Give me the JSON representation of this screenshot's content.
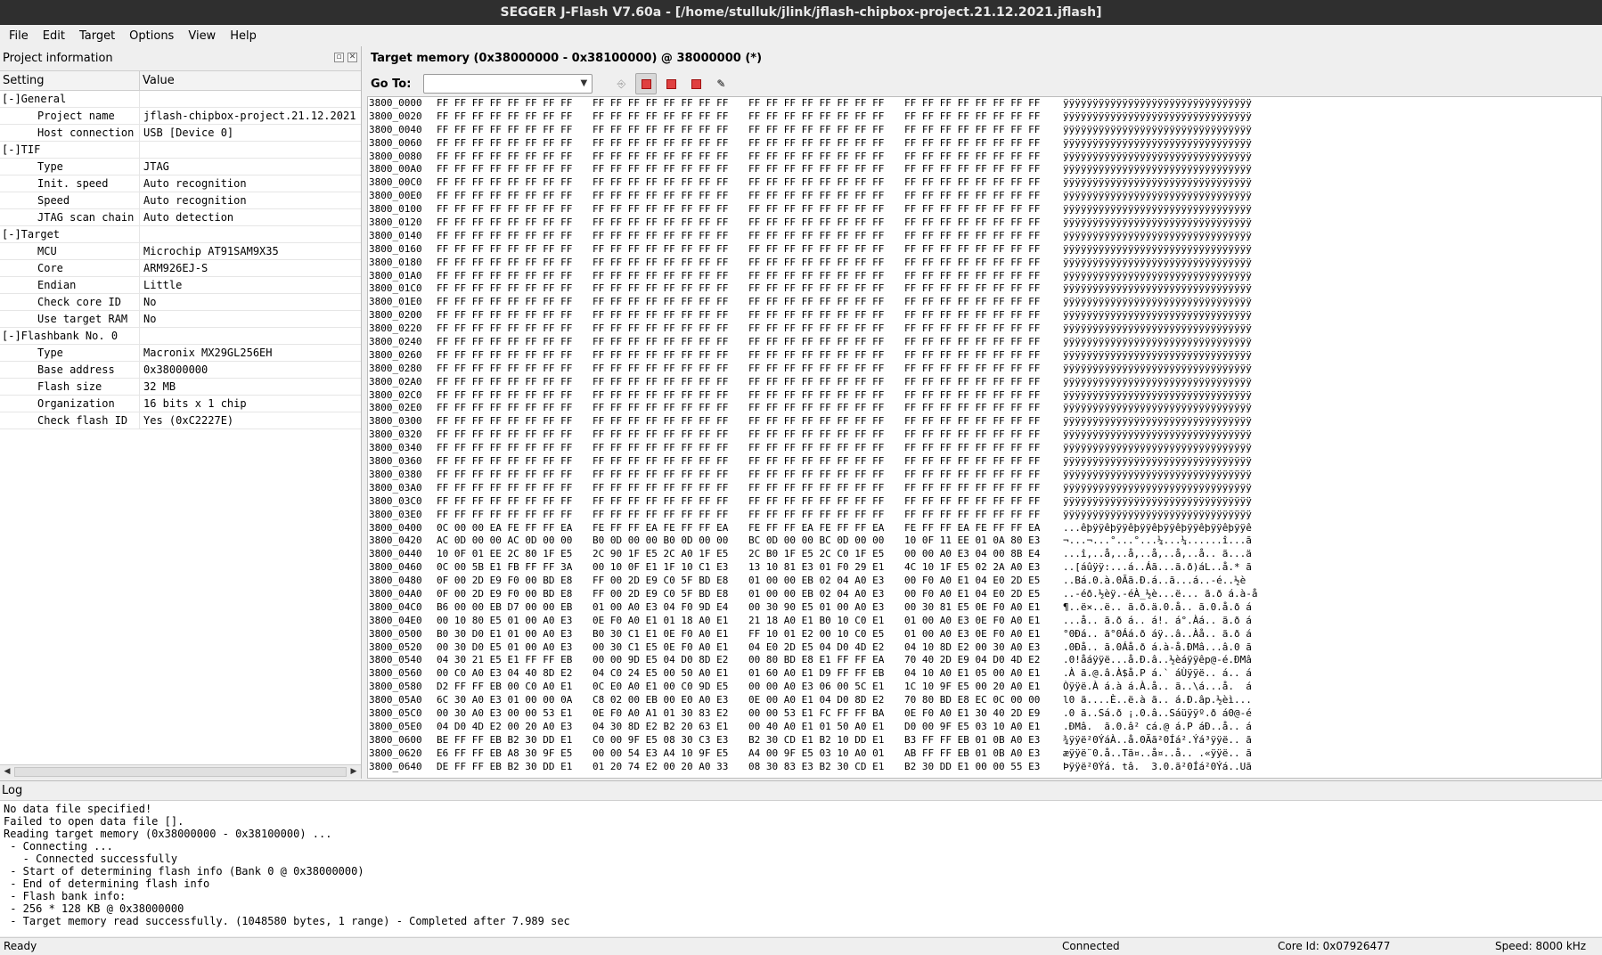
{
  "window": {
    "title": "SEGGER J-Flash V7.60a - [/home/stulluk/jlink/jflash-chipbox-project.21.12.2021.jflash]"
  },
  "menu": [
    "File",
    "Edit",
    "Target",
    "Options",
    "View",
    "Help"
  ],
  "project_panel": {
    "title": "Project information",
    "col_setting": "Setting",
    "col_value": "Value",
    "rows": [
      {
        "type": "group",
        "label": "[-]General",
        "value": ""
      },
      {
        "type": "child",
        "label": "Project name",
        "value": "jflash-chipbox-project.21.12.2021"
      },
      {
        "type": "child",
        "label": "Host connection",
        "value": "USB [Device 0]"
      },
      {
        "type": "group",
        "label": "[-]TIF",
        "value": ""
      },
      {
        "type": "child",
        "label": "Type",
        "value": "JTAG"
      },
      {
        "type": "child",
        "label": "Init. speed",
        "value": "Auto recognition"
      },
      {
        "type": "child",
        "label": "Speed",
        "value": "Auto recognition"
      },
      {
        "type": "child",
        "label": "JTAG scan chain",
        "value": "Auto detection"
      },
      {
        "type": "group",
        "label": "[-]Target",
        "value": ""
      },
      {
        "type": "child",
        "label": "MCU",
        "value": "Microchip AT91SAM9X35"
      },
      {
        "type": "child",
        "label": "Core",
        "value": "ARM926EJ-S"
      },
      {
        "type": "child",
        "label": "Endian",
        "value": "Little"
      },
      {
        "type": "child",
        "label": "Check core ID",
        "value": "No"
      },
      {
        "type": "child",
        "label": "Use target RAM",
        "value": "No"
      },
      {
        "type": "group",
        "label": "[-]Flashbank No. 0",
        "value": ""
      },
      {
        "type": "child",
        "label": "Type",
        "value": "Macronix MX29GL256EH"
      },
      {
        "type": "child",
        "label": "Base address",
        "value": "0x38000000"
      },
      {
        "type": "child",
        "label": "Flash size",
        "value": "32 MB"
      },
      {
        "type": "child",
        "label": "Organization",
        "value": "16 bits x 1 chip"
      },
      {
        "type": "child",
        "label": "Check flash ID",
        "value": "Yes (0xC2227E)"
      }
    ]
  },
  "memory_panel": {
    "title": "Target memory (0x38000000 - 0x38100000) @ 38000000 (*)",
    "goto_label": "Go To:",
    "goto_value": "",
    "lines": [
      [
        "3800_0000",
        "FF FF FF FF FF FF FF FF",
        "FF FF FF FF FF FF FF FF",
        "FF FF FF FF FF FF FF FF",
        "FF FF FF FF FF FF FF FF",
        "ÿÿÿÿÿÿÿÿÿÿÿÿÿÿÿÿÿÿÿÿÿÿÿÿÿÿÿÿÿÿÿÿ"
      ],
      [
        "3800_0020",
        "FF FF FF FF FF FF FF FF",
        "FF FF FF FF FF FF FF FF",
        "FF FF FF FF FF FF FF FF",
        "FF FF FF FF FF FF FF FF",
        "ÿÿÿÿÿÿÿÿÿÿÿÿÿÿÿÿÿÿÿÿÿÿÿÿÿÿÿÿÿÿÿÿ"
      ],
      [
        "3800_0040",
        "FF FF FF FF FF FF FF FF",
        "FF FF FF FF FF FF FF FF",
        "FF FF FF FF FF FF FF FF",
        "FF FF FF FF FF FF FF FF",
        "ÿÿÿÿÿÿÿÿÿÿÿÿÿÿÿÿÿÿÿÿÿÿÿÿÿÿÿÿÿÿÿÿ"
      ],
      [
        "3800_0060",
        "FF FF FF FF FF FF FF FF",
        "FF FF FF FF FF FF FF FF",
        "FF FF FF FF FF FF FF FF",
        "FF FF FF FF FF FF FF FF",
        "ÿÿÿÿÿÿÿÿÿÿÿÿÿÿÿÿÿÿÿÿÿÿÿÿÿÿÿÿÿÿÿÿ"
      ],
      [
        "3800_0080",
        "FF FF FF FF FF FF FF FF",
        "FF FF FF FF FF FF FF FF",
        "FF FF FF FF FF FF FF FF",
        "FF FF FF FF FF FF FF FF",
        "ÿÿÿÿÿÿÿÿÿÿÿÿÿÿÿÿÿÿÿÿÿÿÿÿÿÿÿÿÿÿÿÿ"
      ],
      [
        "3800_00A0",
        "FF FF FF FF FF FF FF FF",
        "FF FF FF FF FF FF FF FF",
        "FF FF FF FF FF FF FF FF",
        "FF FF FF FF FF FF FF FF",
        "ÿÿÿÿÿÿÿÿÿÿÿÿÿÿÿÿÿÿÿÿÿÿÿÿÿÿÿÿÿÿÿÿ"
      ],
      [
        "3800_00C0",
        "FF FF FF FF FF FF FF FF",
        "FF FF FF FF FF FF FF FF",
        "FF FF FF FF FF FF FF FF",
        "FF FF FF FF FF FF FF FF",
        "ÿÿÿÿÿÿÿÿÿÿÿÿÿÿÿÿÿÿÿÿÿÿÿÿÿÿÿÿÿÿÿÿ"
      ],
      [
        "3800_00E0",
        "FF FF FF FF FF FF FF FF",
        "FF FF FF FF FF FF FF FF",
        "FF FF FF FF FF FF FF FF",
        "FF FF FF FF FF FF FF FF",
        "ÿÿÿÿÿÿÿÿÿÿÿÿÿÿÿÿÿÿÿÿÿÿÿÿÿÿÿÿÿÿÿÿ"
      ],
      [
        "3800_0100",
        "FF FF FF FF FF FF FF FF",
        "FF FF FF FF FF FF FF FF",
        "FF FF FF FF FF FF FF FF",
        "FF FF FF FF FF FF FF FF",
        "ÿÿÿÿÿÿÿÿÿÿÿÿÿÿÿÿÿÿÿÿÿÿÿÿÿÿÿÿÿÿÿÿ"
      ],
      [
        "3800_0120",
        "FF FF FF FF FF FF FF FF",
        "FF FF FF FF FF FF FF FF",
        "FF FF FF FF FF FF FF FF",
        "FF FF FF FF FF FF FF FF",
        "ÿÿÿÿÿÿÿÿÿÿÿÿÿÿÿÿÿÿÿÿÿÿÿÿÿÿÿÿÿÿÿÿ"
      ],
      [
        "3800_0140",
        "FF FF FF FF FF FF FF FF",
        "FF FF FF FF FF FF FF FF",
        "FF FF FF FF FF FF FF FF",
        "FF FF FF FF FF FF FF FF",
        "ÿÿÿÿÿÿÿÿÿÿÿÿÿÿÿÿÿÿÿÿÿÿÿÿÿÿÿÿÿÿÿÿ"
      ],
      [
        "3800_0160",
        "FF FF FF FF FF FF FF FF",
        "FF FF FF FF FF FF FF FF",
        "FF FF FF FF FF FF FF FF",
        "FF FF FF FF FF FF FF FF",
        "ÿÿÿÿÿÿÿÿÿÿÿÿÿÿÿÿÿÿÿÿÿÿÿÿÿÿÿÿÿÿÿÿ"
      ],
      [
        "3800_0180",
        "FF FF FF FF FF FF FF FF",
        "FF FF FF FF FF FF FF FF",
        "FF FF FF FF FF FF FF FF",
        "FF FF FF FF FF FF FF FF",
        "ÿÿÿÿÿÿÿÿÿÿÿÿÿÿÿÿÿÿÿÿÿÿÿÿÿÿÿÿÿÿÿÿ"
      ],
      [
        "3800_01A0",
        "FF FF FF FF FF FF FF FF",
        "FF FF FF FF FF FF FF FF",
        "FF FF FF FF FF FF FF FF",
        "FF FF FF FF FF FF FF FF",
        "ÿÿÿÿÿÿÿÿÿÿÿÿÿÿÿÿÿÿÿÿÿÿÿÿÿÿÿÿÿÿÿÿ"
      ],
      [
        "3800_01C0",
        "FF FF FF FF FF FF FF FF",
        "FF FF FF FF FF FF FF FF",
        "FF FF FF FF FF FF FF FF",
        "FF FF FF FF FF FF FF FF",
        "ÿÿÿÿÿÿÿÿÿÿÿÿÿÿÿÿÿÿÿÿÿÿÿÿÿÿÿÿÿÿÿÿ"
      ],
      [
        "3800_01E0",
        "FF FF FF FF FF FF FF FF",
        "FF FF FF FF FF FF FF FF",
        "FF FF FF FF FF FF FF FF",
        "FF FF FF FF FF FF FF FF",
        "ÿÿÿÿÿÿÿÿÿÿÿÿÿÿÿÿÿÿÿÿÿÿÿÿÿÿÿÿÿÿÿÿ"
      ],
      [
        "3800_0200",
        "FF FF FF FF FF FF FF FF",
        "FF FF FF FF FF FF FF FF",
        "FF FF FF FF FF FF FF FF",
        "FF FF FF FF FF FF FF FF",
        "ÿÿÿÿÿÿÿÿÿÿÿÿÿÿÿÿÿÿÿÿÿÿÿÿÿÿÿÿÿÿÿÿ"
      ],
      [
        "3800_0220",
        "FF FF FF FF FF FF FF FF",
        "FF FF FF FF FF FF FF FF",
        "FF FF FF FF FF FF FF FF",
        "FF FF FF FF FF FF FF FF",
        "ÿÿÿÿÿÿÿÿÿÿÿÿÿÿÿÿÿÿÿÿÿÿÿÿÿÿÿÿÿÿÿÿ"
      ],
      [
        "3800_0240",
        "FF FF FF FF FF FF FF FF",
        "FF FF FF FF FF FF FF FF",
        "FF FF FF FF FF FF FF FF",
        "FF FF FF FF FF FF FF FF",
        "ÿÿÿÿÿÿÿÿÿÿÿÿÿÿÿÿÿÿÿÿÿÿÿÿÿÿÿÿÿÿÿÿ"
      ],
      [
        "3800_0260",
        "FF FF FF FF FF FF FF FF",
        "FF FF FF FF FF FF FF FF",
        "FF FF FF FF FF FF FF FF",
        "FF FF FF FF FF FF FF FF",
        "ÿÿÿÿÿÿÿÿÿÿÿÿÿÿÿÿÿÿÿÿÿÿÿÿÿÿÿÿÿÿÿÿ"
      ],
      [
        "3800_0280",
        "FF FF FF FF FF FF FF FF",
        "FF FF FF FF FF FF FF FF",
        "FF FF FF FF FF FF FF FF",
        "FF FF FF FF FF FF FF FF",
        "ÿÿÿÿÿÿÿÿÿÿÿÿÿÿÿÿÿÿÿÿÿÿÿÿÿÿÿÿÿÿÿÿ"
      ],
      [
        "3800_02A0",
        "FF FF FF FF FF FF FF FF",
        "FF FF FF FF FF FF FF FF",
        "FF FF FF FF FF FF FF FF",
        "FF FF FF FF FF FF FF FF",
        "ÿÿÿÿÿÿÿÿÿÿÿÿÿÿÿÿÿÿÿÿÿÿÿÿÿÿÿÿÿÿÿÿ"
      ],
      [
        "3800_02C0",
        "FF FF FF FF FF FF FF FF",
        "FF FF FF FF FF FF FF FF",
        "FF FF FF FF FF FF FF FF",
        "FF FF FF FF FF FF FF FF",
        "ÿÿÿÿÿÿÿÿÿÿÿÿÿÿÿÿÿÿÿÿÿÿÿÿÿÿÿÿÿÿÿÿ"
      ],
      [
        "3800_02E0",
        "FF FF FF FF FF FF FF FF",
        "FF FF FF FF FF FF FF FF",
        "FF FF FF FF FF FF FF FF",
        "FF FF FF FF FF FF FF FF",
        "ÿÿÿÿÿÿÿÿÿÿÿÿÿÿÿÿÿÿÿÿÿÿÿÿÿÿÿÿÿÿÿÿ"
      ],
      [
        "3800_0300",
        "FF FF FF FF FF FF FF FF",
        "FF FF FF FF FF FF FF FF",
        "FF FF FF FF FF FF FF FF",
        "FF FF FF FF FF FF FF FF",
        "ÿÿÿÿÿÿÿÿÿÿÿÿÿÿÿÿÿÿÿÿÿÿÿÿÿÿÿÿÿÿÿÿ"
      ],
      [
        "3800_0320",
        "FF FF FF FF FF FF FF FF",
        "FF FF FF FF FF FF FF FF",
        "FF FF FF FF FF FF FF FF",
        "FF FF FF FF FF FF FF FF",
        "ÿÿÿÿÿÿÿÿÿÿÿÿÿÿÿÿÿÿÿÿÿÿÿÿÿÿÿÿÿÿÿÿ"
      ],
      [
        "3800_0340",
        "FF FF FF FF FF FF FF FF",
        "FF FF FF FF FF FF FF FF",
        "FF FF FF FF FF FF FF FF",
        "FF FF FF FF FF FF FF FF",
        "ÿÿÿÿÿÿÿÿÿÿÿÿÿÿÿÿÿÿÿÿÿÿÿÿÿÿÿÿÿÿÿÿ"
      ],
      [
        "3800_0360",
        "FF FF FF FF FF FF FF FF",
        "FF FF FF FF FF FF FF FF",
        "FF FF FF FF FF FF FF FF",
        "FF FF FF FF FF FF FF FF",
        "ÿÿÿÿÿÿÿÿÿÿÿÿÿÿÿÿÿÿÿÿÿÿÿÿÿÿÿÿÿÿÿÿ"
      ],
      [
        "3800_0380",
        "FF FF FF FF FF FF FF FF",
        "FF FF FF FF FF FF FF FF",
        "FF FF FF FF FF FF FF FF",
        "FF FF FF FF FF FF FF FF",
        "ÿÿÿÿÿÿÿÿÿÿÿÿÿÿÿÿÿÿÿÿÿÿÿÿÿÿÿÿÿÿÿÿ"
      ],
      [
        "3800_03A0",
        "FF FF FF FF FF FF FF FF",
        "FF FF FF FF FF FF FF FF",
        "FF FF FF FF FF FF FF FF",
        "FF FF FF FF FF FF FF FF",
        "ÿÿÿÿÿÿÿÿÿÿÿÿÿÿÿÿÿÿÿÿÿÿÿÿÿÿÿÿÿÿÿÿ"
      ],
      [
        "3800_03C0",
        "FF FF FF FF FF FF FF FF",
        "FF FF FF FF FF FF FF FF",
        "FF FF FF FF FF FF FF FF",
        "FF FF FF FF FF FF FF FF",
        "ÿÿÿÿÿÿÿÿÿÿÿÿÿÿÿÿÿÿÿÿÿÿÿÿÿÿÿÿÿÿÿÿ"
      ],
      [
        "3800_03E0",
        "FF FF FF FF FF FF FF FF",
        "FF FF FF FF FF FF FF FF",
        "FF FF FF FF FF FF FF FF",
        "FF FF FF FF FF FF FF FF",
        "ÿÿÿÿÿÿÿÿÿÿÿÿÿÿÿÿÿÿÿÿÿÿÿÿÿÿÿÿÿÿÿÿ"
      ],
      [
        "3800_0400",
        "0C 00 00 EA FE FF FF EA",
        "FE FF FF EA FE FF FF EA",
        "FE FF FF EA FE FF FF EA",
        "FE FF FF EA FE FF FF EA",
        "...êþÿÿêþÿÿêþÿÿêþÿÿêþÿÿêþÿÿêþÿÿê"
      ],
      [
        "3800_0420",
        "AC 0D 00 00 AC 0D 00 00",
        "B0 0D 00 00 B0 0D 00 00",
        "BC 0D 00 00 BC 0D 00 00",
        "10 0F 11 EE 01 0A 80 E3",
        "¬...¬...°...°...¼...¼......î...ã"
      ],
      [
        "3800_0440",
        "10 0F 01 EE 2C 80 1F E5",
        "2C 90 1F E5 2C A0 1F E5",
        "2C B0 1F E5 2C C0 1F E5",
        "00 00 A0 E3 04 00 8B E4",
        "...î,..å,..å,..å,..å,..å.. ã...ä"
      ],
      [
        "3800_0460",
        "0C 00 5B E1 FB FF FF 3A",
        "00 10 0F E1 1F 10 C1 E3",
        "13 10 81 E3 01 F0 29 E1",
        "4C 10 1F E5 02 2A A0 E3",
        "..[áûÿÿ:...á..Áã...ã.ð)áL..å.* ã"
      ],
      [
        "3800_0480",
        "0F 00 2D E9 F0 00 BD E8",
        "FF 00 2D E9 C0 5F BD E8",
        "01 00 00 EB 02 04 A0 E3",
        "00 F0 A0 E1 04 E0 2D E5",
        "..Bá.0.à.0Ãã.Ð.á..ã...á..-é..½è"
      ],
      [
        "3800_04A0",
        "0F 00 2D E9 F0 00 BD E8",
        "FF 00 2D E9 C0 5F BD E8",
        "01 00 00 EB 02 04 A0 E3",
        "00 F0 A0 E1 04 E0 2D E5",
        "..-éð.½èÿ.-éÀ_½è...ë... ã.ð á.à-å"
      ],
      [
        "3800_04C0",
        "B6 00 00 EB D7 00 00 EB",
        "01 00 A0 E3 04 F0 9D E4",
        "00 30 90 E5 01 00 A0 E3",
        "00 30 81 E5 0E F0 A0 E1",
        "¶..ë×..ë.. ã.ð.ä.0.å.. ã.0.å.ð á"
      ],
      [
        "3800_04E0",
        "00 10 80 E5 01 00 A0 E3",
        "0E F0 A0 E1 01 18 A0 E1",
        "21 18 A0 E1 B0 10 C0 E1",
        "01 00 A0 E3 0E F0 A0 E1",
        "...å.. ã.ð á.. á!. á°.Àá.. ã.ð á"
      ],
      [
        "3800_0500",
        "B0 30 D0 E1 01 00 A0 E3",
        "B0 30 C1 E1 0E F0 A0 E1",
        "FF 10 01 E2 00 10 C0 E5",
        "01 00 A0 E3 0E F0 A0 E1",
        "°0Ðá.. ã°0Áá.ð áÿ..â..Àå.. ã.ð á"
      ],
      [
        "3800_0520",
        "00 30 D0 E5 01 00 A0 E3",
        "00 30 C1 E5 0E F0 A0 E1",
        "04 E0 2D E5 04 D0 4D E2",
        "04 10 8D E2 00 30 A0 E3",
        ".0Ðå.. ã.0Áå.ð á.à-å.ÐMâ...â.0 ã"
      ],
      [
        "3800_0540",
        "04 30 21 E5 E1 FF FF EB",
        "00 00 9D E5 04 D0 8D E2",
        "00 80 BD E8 E1 FF FF EA",
        "70 40 2D E9 04 D0 4D E2",
        ".0!åáÿÿë...å.Ð.â..½èáÿÿêp@-é.ÐMâ"
      ],
      [
        "3800_0560",
        "00 C0 A0 E3 04 40 8D E2",
        "04 C0 24 E5 00 50 A0 E1",
        "01 60 A0 E1 D9 FF FF EB",
        "04 10 A0 E1 05 00 A0 E1",
        ".À ã.@.â.À$å.P á.` áÙÿÿë.. á.. á"
      ],
      [
        "3800_0580",
        "D2 FF FF EB 00 C0 A0 E1",
        "0C E0 A0 E1 00 C0 9D E5",
        "00 00 A0 E3 06 00 5C E1",
        "1C 10 9F E5 00 20 A0 E1",
        "Òÿÿë.À á.à á.À.å.. ã..\\á...å.  á"
      ],
      [
        "3800_05A0",
        "6C 30 A0 E3 01 00 00 0A",
        "C8 02 00 EB 00 E0 A0 E3",
        "0E 00 A0 E1 04 D0 8D E2",
        "70 80 BD E8 EC 0C 00 00",
        "l0 ã....È..ë.à ã.. á.Ð.âp.½èì..."
      ],
      [
        "3800_05C0",
        "00 30 A0 E3 00 00 53 E1",
        "0E F0 A0 A1 01 30 83 E2",
        "00 00 53 E1 FC FF FF BA",
        "0E F0 A0 E1 30 40 2D E9",
        ".0 ã..Sá.ð ¡.0.â..Sáüÿÿº.ð á0@-é"
      ],
      [
        "3800_05E0",
        "04 D0 4D E2 00 20 A0 E3",
        "04 30 8D E2 B2 20 63 E1",
        "00 40 A0 E1 01 50 A0 E1",
        "D0 00 9F E5 03 10 A0 E1",
        ".ÐMâ.  ã.0.â² cá.@ á.P áÐ..å.. á"
      ],
      [
        "3800_0600",
        "BE FF FF EB B2 30 DD E1",
        "C0 00 9F E5 08 30 C3 E3",
        "B2 30 CD E1 B2 10 DD E1",
        "B3 FF FF EB 01 0B A0 E3",
        "¾ÿÿë²0ÝáÀ..å.0Ãã²0Íá².Ýá³ÿÿë.. ã"
      ],
      [
        "3800_0620",
        "E6 FF FF EB A8 30 9F E5",
        "00 00 54 E3 A4 10 9F E5",
        "A4 00 9F E5 03 10 A0 01",
        "AB FF FF EB 01 0B A0 E3",
        "æÿÿë¨0.å..Tã¤..å¤..å.. .«ÿÿë.. ã"
      ],
      [
        "3800_0640",
        "DE FF FF EB B2 30 DD E1",
        "01 20 74 E2 00 20 A0 33",
        "08 30 83 E3 B2 30 CD E1",
        "B2 30 DD E1 00 00 55 E3",
        "Þÿÿë²0Ýá. tâ.  3.0.ã²0Íá²0Ýá..Uã"
      ]
    ]
  },
  "log_panel": {
    "title": "Log",
    "lines": [
      "No data file specified!",
      "Failed to open data file [].",
      "Reading target memory (0x38000000 - 0x38100000) ...",
      " - Connecting ...",
      "   - Connected successfully",
      " - Start of determining flash info (Bank 0 @ 0x38000000)",
      " - End of determining flash info",
      " - Flash bank info:",
      " - 256 * 128 KB @ 0x38000000",
      " - Target memory read successfully. (1048580 bytes, 1 range) - Completed after 7.989 sec"
    ]
  },
  "statusbar": {
    "left": "Ready",
    "connection": "Connected",
    "core_id": "Core Id: 0x07926477",
    "speed": "Speed: 8000 kHz"
  }
}
